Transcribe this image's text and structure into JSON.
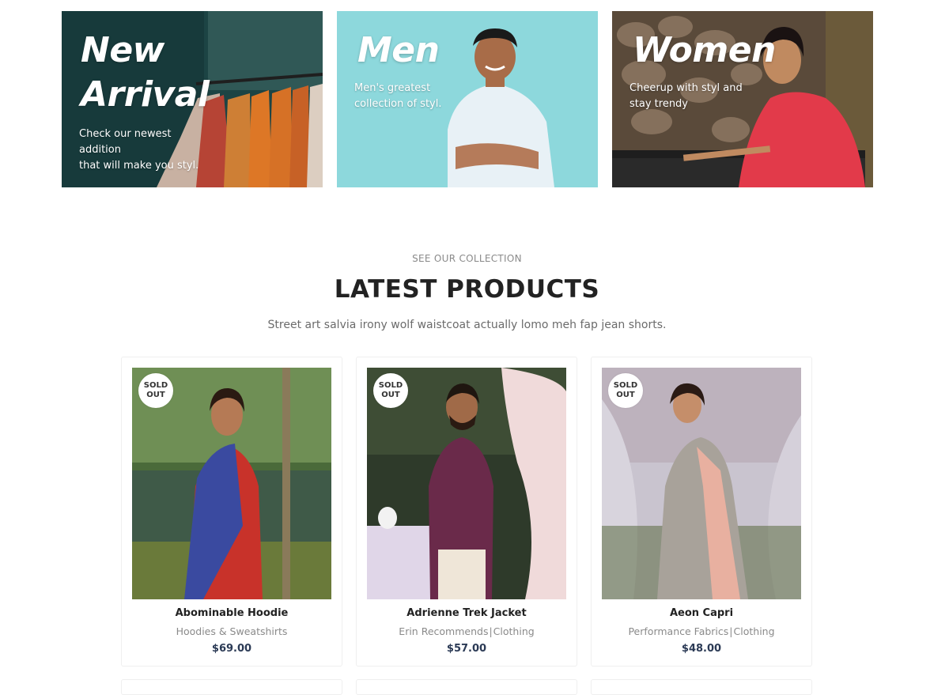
{
  "banners": [
    {
      "title": "New\nArrival",
      "description": "Check our newest\naddition\nthat will make you styl."
    },
    {
      "title": "Men",
      "description": "Men's greatest\ncollection of styl."
    },
    {
      "title": "Women",
      "description": "Cheerup with styl and\nstay trendy"
    }
  ],
  "collection": {
    "eyebrow": "SEE OUR COLLECTION",
    "title": "LATEST PRODUCTS",
    "subtitle": "Street art salvia irony wolf waistcoat actually lomo meh fap jean shorts."
  },
  "products": [
    {
      "badge": "SOLD\nOUT",
      "name": "Abominable Hoodie",
      "categories": [
        "Hoodies & Sweatshirts"
      ],
      "price": "$69.00"
    },
    {
      "badge": "SOLD\nOUT",
      "name": "Adrienne Trek Jacket",
      "categories": [
        "Erin Recommends",
        "Clothing"
      ],
      "price": "$57.00"
    },
    {
      "badge": "SOLD\nOUT",
      "name": "Aeon Capri",
      "categories": [
        "Performance Fabrics",
        "Clothing"
      ],
      "price": "$48.00"
    }
  ],
  "colors": {
    "men_banner_bg": "#8dd8dc",
    "price_text": "#2b3a55",
    "muted_text": "#8a8a8a"
  }
}
